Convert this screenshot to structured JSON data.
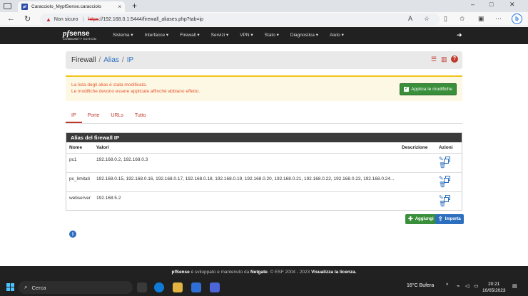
{
  "browser": {
    "tab_title": "Caracciolo_MypfSense.caracciolo",
    "security_label": "Non sicuro",
    "url_protocol": "https",
    "url_rest": "://192.168.0.1:5444/firewall_aliases.php?tab=ip"
  },
  "navbar": {
    "logo_pf": "pf",
    "logo_sense": "sense",
    "logo_edition": "COMMUNITY EDITION",
    "menu": [
      "Sistema ▾",
      "Interfacce ▾",
      "Firewall ▾",
      "Servizi ▾",
      "VPN ▾",
      "Stato ▾",
      "Diagnostica ▾",
      "Aiuto ▾"
    ]
  },
  "breadcrumb": {
    "part1": "Firewall",
    "part2": "Alias",
    "part3": "IP",
    "separator": "/"
  },
  "alert": {
    "line1": "La lista degli alias è stata modificata.",
    "line2": "Le modifiche devono essere applicate affinché abbiano effetto.",
    "apply_label": "Applica le modifiche"
  },
  "tabs": [
    {
      "label": "IP",
      "active": true
    },
    {
      "label": "Porte",
      "active": false
    },
    {
      "label": "URLs",
      "active": false
    },
    {
      "label": "Tutto",
      "active": false
    }
  ],
  "panel": {
    "title": "Alias del firewall IP",
    "columns": {
      "name": "Nome",
      "values": "Valori",
      "description": "Descrizione",
      "actions": "Azioni"
    },
    "rows": [
      {
        "name": "pc1",
        "values": "192.168.0.2, 192.168.0.3",
        "description": ""
      },
      {
        "name": "pc_limitati",
        "values": "192.168.0.15, 192.168.0.16, 192.168.0.17, 192.168.0.18, 192.168.0.19, 192.168.0.20, 192.168.0.21, 192.168.0.22, 192.168.0.23, 192.168.0.24...",
        "description": ""
      },
      {
        "name": "webserver",
        "values": "192.168.5.2",
        "description": ""
      }
    ]
  },
  "buttons": {
    "add": "Aggiungi",
    "import": "Importa"
  },
  "footer": {
    "brand": "pfSense",
    "text1": " è sviluppato e mantenuto da ",
    "company": "Netgate",
    "text2": ". © ESF 2004 - 2023 ",
    "license": "Visualizza la licenza."
  },
  "taskbar": {
    "search_placeholder": "Cerca",
    "weather": "16°C  Bufera",
    "time": "20:21",
    "date": "10/05/2023"
  },
  "colors": {
    "accent_red": "#c0392b",
    "link_blue": "#2c6fbf",
    "green": "#3a8f3a"
  }
}
